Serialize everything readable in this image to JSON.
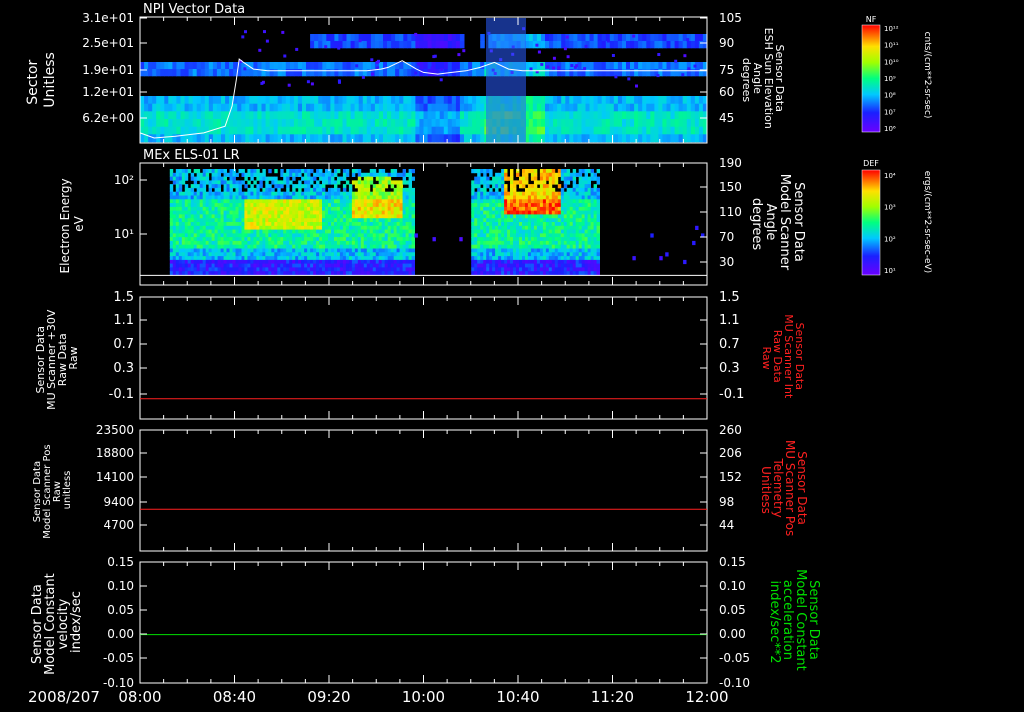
{
  "date_label": "2008/207",
  "time_ticks": [
    "08:00",
    "08:40",
    "09:20",
    "10:00",
    "10:40",
    "11:20",
    "12:00"
  ],
  "colorbars": [
    {
      "label": "NF",
      "unit": "cnts/(cm**2-sr-sec)",
      "ticks": [
        "10¹²",
        "10¹¹",
        "10¹⁰",
        "10⁹",
        "10⁸",
        "10⁷",
        "10⁶"
      ]
    },
    {
      "label": "DEF",
      "unit": "ergs/(cm**2-sr-sec-eV)",
      "ticks": [
        "10⁴",
        "10³",
        "10²",
        "10¹"
      ]
    }
  ],
  "colors": {
    "red": "#ff2020",
    "green": "#00e000",
    "white": "#ffffff"
  },
  "chart_data": [
    {
      "type": "heatmap",
      "title": "NPI Vector Data",
      "ylabel_left": [
        "Sector",
        "Unitless"
      ],
      "ylabel_right": [
        "Sensor Data",
        "ESH Sun Elevation",
        "Angle",
        "degrees"
      ],
      "yticks_left": [
        "3.1e+01",
        "2.5e+01",
        "1.9e+01",
        "1.2e+01",
        "6.2e+00"
      ],
      "yticks_right": [
        "105",
        "90",
        "75",
        "60",
        "45"
      ],
      "xlim": [
        "08:00",
        "12:00"
      ],
      "overlay_line": {
        "name": "ESH Sun Elevation Angle",
        "x_hours": [
          0.0,
          0.1,
          0.25,
          0.45,
          0.6,
          0.65,
          0.68,
          0.7,
          0.73,
          0.8,
          0.9,
          1.2,
          1.4,
          1.6,
          1.7,
          1.75,
          1.85,
          1.95,
          2.0,
          2.1,
          2.2,
          2.3,
          2.4,
          2.5,
          2.6,
          2.7,
          2.8,
          2.9,
          3.0,
          3.3,
          3.6,
          4.0
        ],
        "values": [
          36,
          33,
          34,
          36,
          40,
          52,
          68,
          80,
          78,
          74,
          73,
          73,
          73,
          73,
          74,
          75,
          79,
          74,
          72,
          71,
          72,
          73,
          75,
          78,
          74,
          73,
          73,
          73,
          73,
          73,
          73,
          73
        ],
        "ylim": [
          30,
          105
        ]
      }
    },
    {
      "type": "heatmap",
      "title": "MEx ELS-01 LR",
      "ylabel_left": [
        "Electron Energy",
        "eV"
      ],
      "ylabel_right": [
        "Sensor Data",
        "Model Scanner",
        "Angle",
        "degrees"
      ],
      "yticks_left": [
        "10²",
        "10¹"
      ],
      "yticks_right": [
        "190",
        "150",
        "110",
        "70",
        "30"
      ],
      "xlim": [
        "08:00",
        "12:00"
      ],
      "overlay_line": {
        "name": "Model Scanner Angle",
        "value": 15,
        "ylim": [
          0,
          190
        ]
      }
    },
    {
      "type": "line",
      "ylabel_left": [
        "Sensor Data",
        "MU Scanner +30V",
        "Raw Data",
        "Raw"
      ],
      "ylabel_right": [
        "Sensor Data",
        "MU Scanner Int",
        "Raw Data",
        "Raw"
      ],
      "yticks_left": [
        "1.5",
        "1.1",
        "0.7",
        "0.3",
        "-0.1"
      ],
      "yticks_right": [
        "1.5",
        "1.1",
        "0.7",
        "0.3",
        "-0.1"
      ],
      "ylim": [
        -0.3,
        1.5
      ],
      "series": [
        {
          "color": "#ff2020",
          "x": [
            "08:00",
            "12:00"
          ],
          "values": [
            0.0,
            0.0
          ]
        }
      ]
    },
    {
      "type": "line",
      "ylabel_left": [
        "Sensor Data",
        "Model Scanner Pos",
        "Raw",
        "unitless"
      ],
      "ylabel_right": [
        "Sensor Data",
        "MU Scanner Pos",
        "Telemetry",
        "Unitless"
      ],
      "yticks_left": [
        "23500",
        "18800",
        "14100",
        "9400",
        "4700"
      ],
      "yticks_right": [
        "260",
        "206",
        "152",
        "98",
        "44"
      ],
      "ylim": [
        0,
        23500
      ],
      "series": [
        {
          "color": "#ff2020",
          "x": [
            "08:00",
            "12:00"
          ],
          "values": [
            8100,
            8100
          ]
        }
      ]
    },
    {
      "type": "line",
      "ylabel_left": [
        "Sensor Data",
        "Model Constant",
        "velocity",
        "index/sec"
      ],
      "ylabel_right": [
        "Sensor Data",
        "Model Constant",
        "acceleration",
        "index/sec**2"
      ],
      "yticks_left": [
        "0.15",
        "0.10",
        "0.05",
        "0.00",
        "-0.05",
        "-0.10"
      ],
      "yticks_right": [
        "0.15",
        "0.10",
        "0.05",
        "0.00",
        "-0.05",
        "-0.10"
      ],
      "ylim": [
        -0.1,
        0.15
      ],
      "series": [
        {
          "color": "#00e000",
          "x": [
            "08:00",
            "12:00"
          ],
          "values": [
            0.0,
            0.0
          ]
        }
      ]
    }
  ]
}
